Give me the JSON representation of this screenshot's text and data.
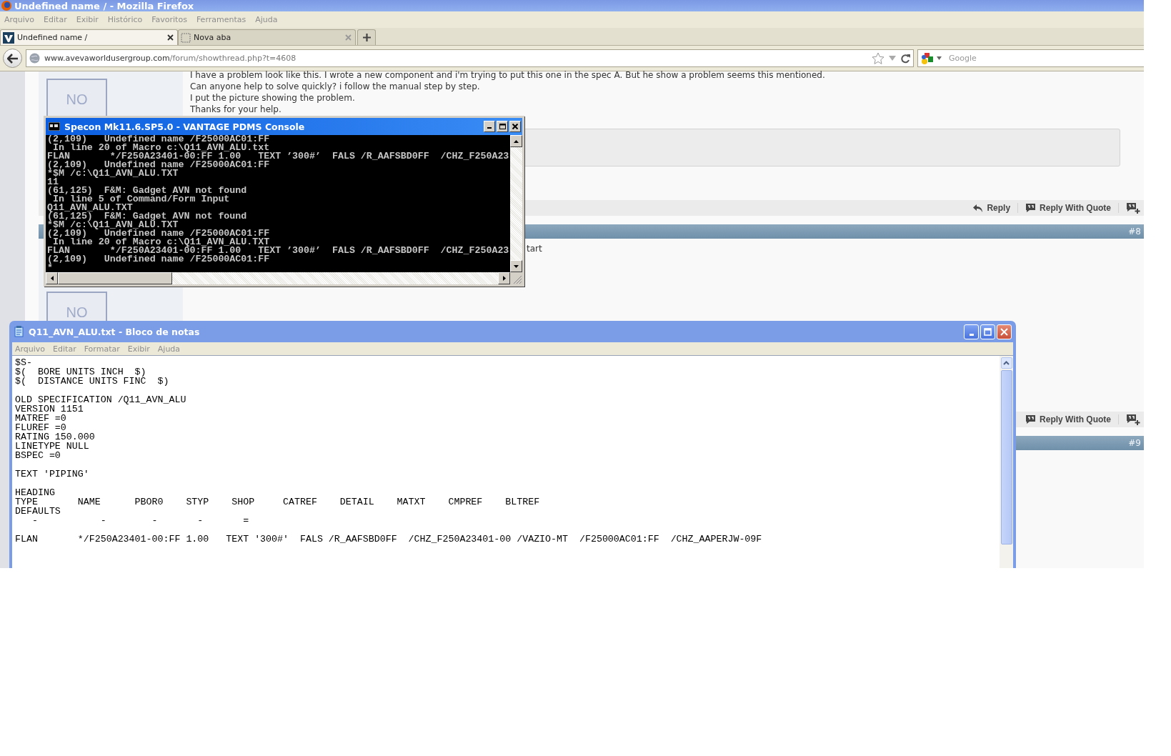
{
  "browser": {
    "title": "Undefined name / - Mozilla Firefox",
    "menu": [
      "Arquivo",
      "Editar",
      "Exibir",
      "Histórico",
      "Favoritos",
      "Ferramentas",
      "Ajuda"
    ],
    "tabs": [
      {
        "label": "Undefined name /",
        "selected": true
      },
      {
        "label": "Nova aba",
        "selected": false
      }
    ],
    "address": {
      "host": "www.avevaworldusergroup.com",
      "path": "/forum/showthread.php?t=4608"
    },
    "search": {
      "placeholder": "Google"
    }
  },
  "thread": {
    "posts": [
      {
        "avatar": "NO",
        "lines": [
          "I have a problem look like this. I wrote a new component and i'm trying to put this one in the spec A. But he show a problem seems this mentioned.",
          "Can anyone help to solve quickly? i follow the manual step by step.",
          "I put the picture showing the problem.",
          "Thanks for your help."
        ],
        "quote": true,
        "actions": [
          {
            "kind": "reply",
            "label": "Reply"
          },
          {
            "kind": "quote",
            "label": "Reply With Quote"
          }
        ]
      },
      {
        "number": "#8",
        "avatar": "NO",
        "lines": [
          "tart"
        ],
        "actions": [
          {
            "kind": "quote",
            "label": "Reply With Quote"
          }
        ]
      },
      {
        "number": "#9"
      }
    ]
  },
  "console": {
    "title": "Specon Mk11.6.SP5.0 - VANTAGE PDMS Console",
    "lines": [
      "(2,109)   Undefined name /F25000AC01:FF",
      " In line 20 of Macro c:\\Q11_AVN_ALU.txt",
      "FLAN       */F250A23401-00:FF 1.00   TEXT ’300#’  FALS /R_AAFSBD0FF  /CHZ_F250A23",
      "(2,109)   Undefined name /F25000AC01:FF",
      "*$M /c:\\Q11_AVN_ALU.TXT",
      "11",
      "(61,125)  F&M: Gadget AVN not found",
      " In line 5 of Command/Form Input",
      "Q11_AVN_ALU.TXT",
      "(61,125)  F&M: Gadget AVN not found",
      "*$M /c:\\Q11_AVN_ALU.TXT",
      "(2,109)   Undefined name /F25000AC01:FF",
      " In line 20 of Macro c:\\Q11_AVN_ALU.TXT",
      "FLAN       */F250A23401-00:FF 1.00   TEXT ’300#’  FALS /R_AAFSBD0FF  /CHZ_F250A23",
      "(2,109)   Undefined name /F25000AC01:FF",
      "*"
    ]
  },
  "notepad": {
    "title": "Q11_AVN_ALU.txt - Bloco de notas",
    "menu": [
      "Arquivo",
      "Editar",
      "Formatar",
      "Exibir",
      "Ajuda"
    ],
    "blocks": [
      [
        "$S-",
        "$(  BORE UNITS INCH  $)",
        "$(  DISTANCE UNITS FINC  $)"
      ],
      [
        "OLD SPECIFICATION /Q11_AVN_ALU",
        "VERSION 1151",
        "MATREF =0",
        "FLUREF =0",
        "RATING 150.000",
        "LINETYPE NULL",
        "BSPEC =0"
      ],
      [
        "TEXT 'PIPING'"
      ],
      [
        "HEADING",
        "TYPE       NAME      PBOR0    STYP    SHOP     CATREF    DETAIL    MATXT    CMPREF    BLTREF",
        "DEFAULTS",
        "   -           -        -       -       ="
      ],
      [
        "FLAN       */F250A23401-00:FF 1.00   TEXT '300#'  FALS /R_AAFSBD0FF  /CHZ_F250A23401-00 /VAZIO-MT  /F25000AC01:FF  /CHZ_AAPERJW-09F"
      ]
    ]
  }
}
